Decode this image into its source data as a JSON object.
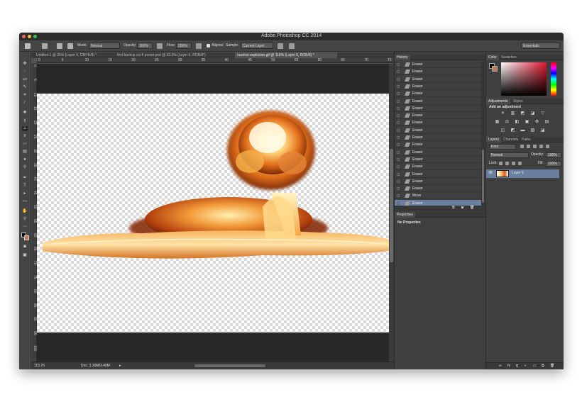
{
  "window": {
    "title": "Adobe Photoshop CC 2014",
    "traffic_colors": [
      "#fc605b",
      "#fdbc40",
      "#34c84a"
    ]
  },
  "options_bar": {
    "mode_label": "Mode:",
    "mode_value": "Normal",
    "opacity_label": "Opacity:",
    "opacity_value": "100%",
    "flow_label": "Flow:",
    "flow_value": "100%",
    "aligned_label": "Aligned",
    "sample_label": "Sample:",
    "sample_value": "Current Layer",
    "workspace_value": "Essentials"
  },
  "tabs": [
    {
      "label": "Untitled-1 @ 25% (Layer 0, CMYK/8) *",
      "active": false
    },
    {
      "label": "first backup sci-fi poster.psd @ 33.3% (Layer 6, RGB/8*)",
      "active": false
    },
    {
      "label": "nuclear-explosion.gif @ 116% (Layer 6, RGB/8) *",
      "active": true
    }
  ],
  "ruler_h": [
    "0",
    "5",
    "10",
    "15",
    "20",
    "25",
    "30",
    "35",
    "40",
    "45",
    "50",
    "55",
    "60",
    "65",
    "70",
    "75"
  ],
  "ruler_v": [
    "0",
    "5",
    "10",
    "15",
    "20",
    "25",
    "30",
    "35",
    "40",
    "45",
    "50",
    "55",
    "60",
    "65",
    "70",
    "75",
    "80",
    "85",
    "90",
    "95",
    "100"
  ],
  "status": {
    "zoom": "115.76",
    "doc": "Doc: 2.30M/3.49M"
  },
  "history": {
    "tab_label": "History",
    "items": [
      "Eraser",
      "Eraser",
      "Eraser",
      "Eraser",
      "Eraser",
      "Eraser",
      "Eraser",
      "Eraser",
      "Eraser",
      "Eraser",
      "Eraser",
      "Eraser",
      "Eraser",
      "Eraser",
      "Eraser",
      "Eraser",
      "Eraser",
      "Eraser",
      "Move",
      "Eraser"
    ],
    "selected_index": 19
  },
  "properties": {
    "tab_label": "Properties",
    "empty_text": "No Properties"
  },
  "color_panel": {
    "tabs": [
      "Color",
      "Swatches"
    ],
    "fg_color": "#000000",
    "bg_color": "#c07c5a"
  },
  "adjustments": {
    "tabs": [
      "Adjustments",
      "Styles"
    ],
    "heading": "Add an adjustment",
    "row1": [
      "☀",
      "▥",
      "◩",
      "◪",
      "▽"
    ],
    "row2": [
      "▦",
      "⚖",
      "◧",
      "▣",
      "♻",
      "▤"
    ],
    "row3": [
      "◫",
      "◩",
      "▬",
      "▨",
      "◪"
    ]
  },
  "layers": {
    "tabs": [
      "Layers",
      "Channels",
      "Paths"
    ],
    "filter_value": "Kind",
    "blend_value": "Normal",
    "opacity_label": "Opacity:",
    "opacity_value": "100%",
    "lock_label": "Lock:",
    "fill_label": "Fill:",
    "fill_value": "100%",
    "layer_name": "Layer 6"
  }
}
